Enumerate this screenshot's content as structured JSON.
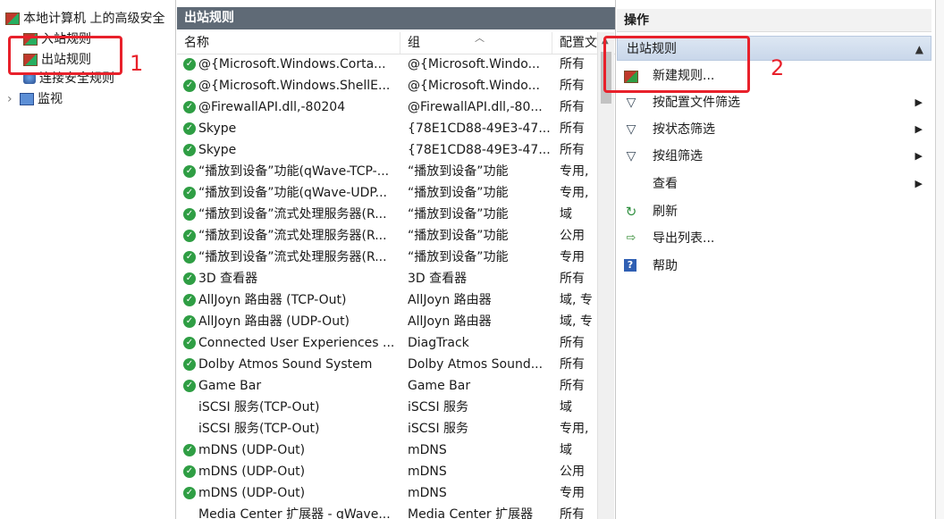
{
  "tree": {
    "root": "本地计算机 上的高级安全",
    "items": [
      {
        "label": "入站规则"
      },
      {
        "label": "出站规则"
      },
      {
        "label": "连接安全规则"
      },
      {
        "label": "监视"
      }
    ],
    "expand_glyph": "›"
  },
  "rules_pane": {
    "title": "出站规则",
    "columns": [
      "名称",
      "组",
      "配置文"
    ],
    "rows": [
      {
        "name": "@{Microsoft.Windows.Corta...",
        "group": "@{Microsoft.Windo...",
        "profile": "所有",
        "enabled": true
      },
      {
        "name": "@{Microsoft.Windows.ShellE...",
        "group": "@{Microsoft.Windo...",
        "profile": "所有",
        "enabled": true
      },
      {
        "name": "@FirewallAPI.dll,-80204",
        "group": "@FirewallAPI.dll,-80...",
        "profile": "所有",
        "enabled": true
      },
      {
        "name": "Skype",
        "group": "{78E1CD88-49E3-47...",
        "profile": "所有",
        "enabled": true
      },
      {
        "name": "Skype",
        "group": "{78E1CD88-49E3-47...",
        "profile": "所有",
        "enabled": true
      },
      {
        "name": "“播放到设备”功能(qWave-TCP-...",
        "group": "“播放到设备”功能",
        "profile": "专用, ",
        "enabled": true
      },
      {
        "name": "“播放到设备”功能(qWave-UDP...",
        "group": "“播放到设备”功能",
        "profile": "专用, ",
        "enabled": true
      },
      {
        "name": "“播放到设备”流式处理服务器(R...",
        "group": "“播放到设备”功能",
        "profile": "域",
        "enabled": true
      },
      {
        "name": "“播放到设备”流式处理服务器(R...",
        "group": "“播放到设备”功能",
        "profile": "公用",
        "enabled": true
      },
      {
        "name": "“播放到设备”流式处理服务器(R...",
        "group": "“播放到设备”功能",
        "profile": "专用",
        "enabled": true
      },
      {
        "name": "3D 查看器",
        "group": "3D 查看器",
        "profile": "所有",
        "enabled": true
      },
      {
        "name": "AllJoyn 路由器 (TCP-Out)",
        "group": "AllJoyn 路由器",
        "profile": "域, 专",
        "enabled": true
      },
      {
        "name": "AllJoyn 路由器 (UDP-Out)",
        "group": "AllJoyn 路由器",
        "profile": "域, 专",
        "enabled": true
      },
      {
        "name": "Connected User Experiences ...",
        "group": "DiagTrack",
        "profile": "所有",
        "enabled": true
      },
      {
        "name": "Dolby Atmos Sound System",
        "group": "Dolby Atmos Sound...",
        "profile": "所有",
        "enabled": true
      },
      {
        "name": "Game Bar",
        "group": "Game Bar",
        "profile": "所有",
        "enabled": true
      },
      {
        "name": "iSCSI 服务(TCP-Out)",
        "group": "iSCSI 服务",
        "profile": "域",
        "enabled": false
      },
      {
        "name": "iSCSI 服务(TCP-Out)",
        "group": "iSCSI 服务",
        "profile": "专用, ",
        "enabled": false
      },
      {
        "name": "mDNS (UDP-Out)",
        "group": "mDNS",
        "profile": "域",
        "enabled": true
      },
      {
        "name": "mDNS (UDP-Out)",
        "group": "mDNS",
        "profile": "公用",
        "enabled": true
      },
      {
        "name": "mDNS (UDP-Out)",
        "group": "mDNS",
        "profile": "专用",
        "enabled": true
      },
      {
        "name": "Media Center 扩展器 - qWave...",
        "group": "Media Center 扩展器",
        "profile": "所有",
        "enabled": false
      }
    ]
  },
  "actions": {
    "title": "操作",
    "section": "出站规则",
    "items": [
      {
        "label": "新建规则...",
        "icon": "new-rule-icon",
        "submenu": false
      },
      {
        "label": "按配置文件筛选",
        "icon": "filter-icon",
        "submenu": true
      },
      {
        "label": "按状态筛选",
        "icon": "filter-icon",
        "submenu": true
      },
      {
        "label": "按组筛选",
        "icon": "filter-icon",
        "submenu": true
      },
      {
        "label": "查看",
        "icon": "",
        "submenu": true
      },
      {
        "label": "刷新",
        "icon": "refresh-icon",
        "submenu": false
      },
      {
        "label": "导出列表...",
        "icon": "export-icon",
        "submenu": false
      },
      {
        "label": "帮助",
        "icon": "help-icon",
        "submenu": false
      }
    ]
  },
  "annotations": {
    "step1": "1",
    "step2": "2",
    "color": "#e8212b"
  }
}
